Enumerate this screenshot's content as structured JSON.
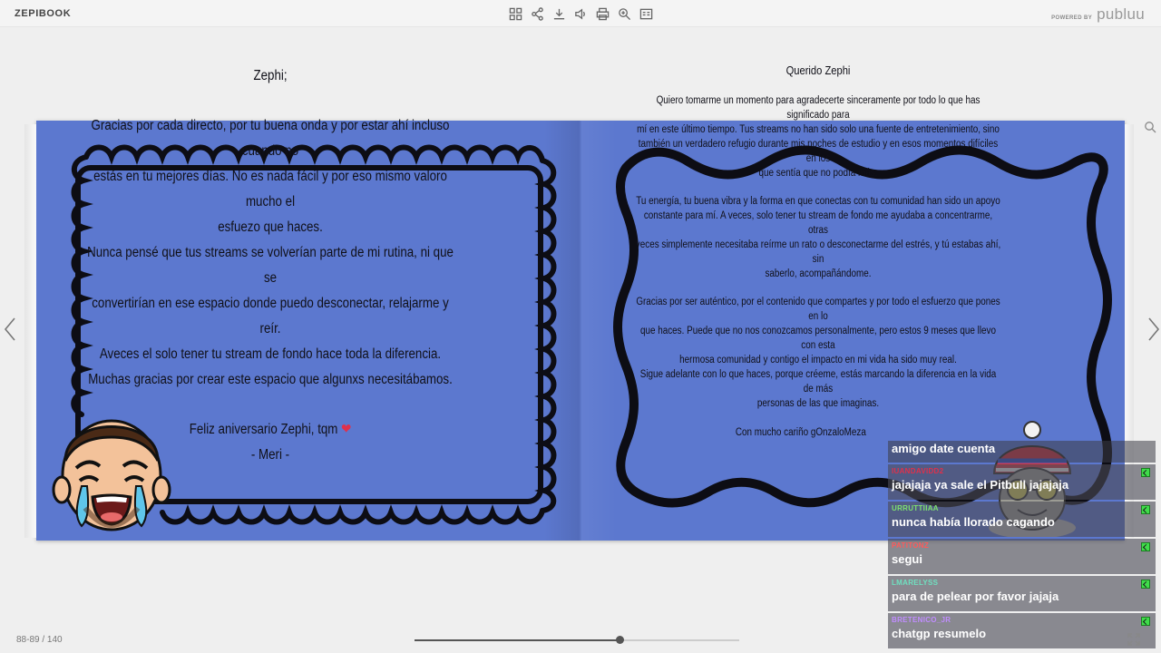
{
  "app": {
    "brand": "ZEPIBOOK",
    "powered_by": "POWERED BY",
    "logo": "publuu"
  },
  "toolbar": [
    "grid-icon",
    "share-icon",
    "download-icon",
    "sound-icon",
    "print-icon",
    "zoom-icon",
    "toc-icon"
  ],
  "pagination": {
    "label": "88-89 / 140",
    "progress": 0.63
  },
  "left_page": {
    "title": "Zephi;",
    "lines": [
      "Gracias por cada directo, por tu buena onda y por estar ahí incluso cuando no",
      "estás en tu mejores días. No es nada fácil y por eso mismo valoro mucho el",
      "esfuezo que haces.",
      "Nunca pensé que tus streams se volverían parte de mi rutina, ni que se",
      "convertirían en ese espacio donde puedo desconectar, relajarme y reír.",
      "Aveces el solo tener tu stream de fondo hace toda la diferencia.",
      "Muchas gracias por crear este espacio que algunxs necesitábamos."
    ],
    "closing": "Feliz aniversario Zephi, tqm",
    "heart": "❤",
    "signature": "- Meri -"
  },
  "right_page": {
    "title": "Querido Zephi",
    "paragraphs": [
      [
        "Quiero tomarme un momento para agradecerte sinceramente por todo lo que has significado para",
        "mí en este último tiempo. Tus streams no han sido solo una fuente de entretenimiento, sino",
        "también un verdadero refugio durante mis noches de estudio y en esos momentos difíciles en los",
        "que sentía que no podía más."
      ],
      [
        "Tu energía, tu buena vibra y la forma en que conectas con tu comunidad han sido un apoyo",
        "constante para mí. A veces, solo tener tu stream de fondo me ayudaba a concentrarme, otras",
        "veces simplemente necesitaba reírme un rato o desconectarme del estrés, y tú estabas ahí, sin",
        "saberlo, acompañándome."
      ],
      [
        "Gracias por ser auténtico, por el contenido que compartes y por todo el esfuerzo que pones en lo",
        "que haces. Puede que no nos conozcamos personalmente, pero estos 9 meses que llevo con esta",
        "hermosa comunidad y contigo el  impacto en mi vida ha sido muy real.",
        "Sigue adelante con lo que haces, porque créeme, estás marcando la diferencia en la vida de más",
        "personas de las que imaginas."
      ]
    ],
    "signature": "Con mucho cariño gOnzaloMeza"
  },
  "chat": {
    "first_text": "amigo date cuenta",
    "messages": [
      {
        "user": "IUANDAVIDD2",
        "color": "#e0304b",
        "text": "jajajaja ya sale el Pitbull jajajaja"
      },
      {
        "user": "URRUTTIIAA",
        "color": "#7ee36f",
        "text": "nunca había llorado cagando"
      },
      {
        "user": "PATITONZ",
        "color": "#ff5a5a",
        "text": "segui"
      },
      {
        "user": "LMARELYSS",
        "color": "#6fe0c0",
        "text": "para de pelear por favor jajaja"
      },
      {
        "user": "BRETENICO_JR",
        "color": "#c08cff",
        "text": "chatgp resumelo"
      }
    ]
  },
  "colors": {
    "page_bg": "#5c78cf",
    "ink": "#101018",
    "heart": "#e0304b",
    "badge": "#3fdc4a"
  }
}
